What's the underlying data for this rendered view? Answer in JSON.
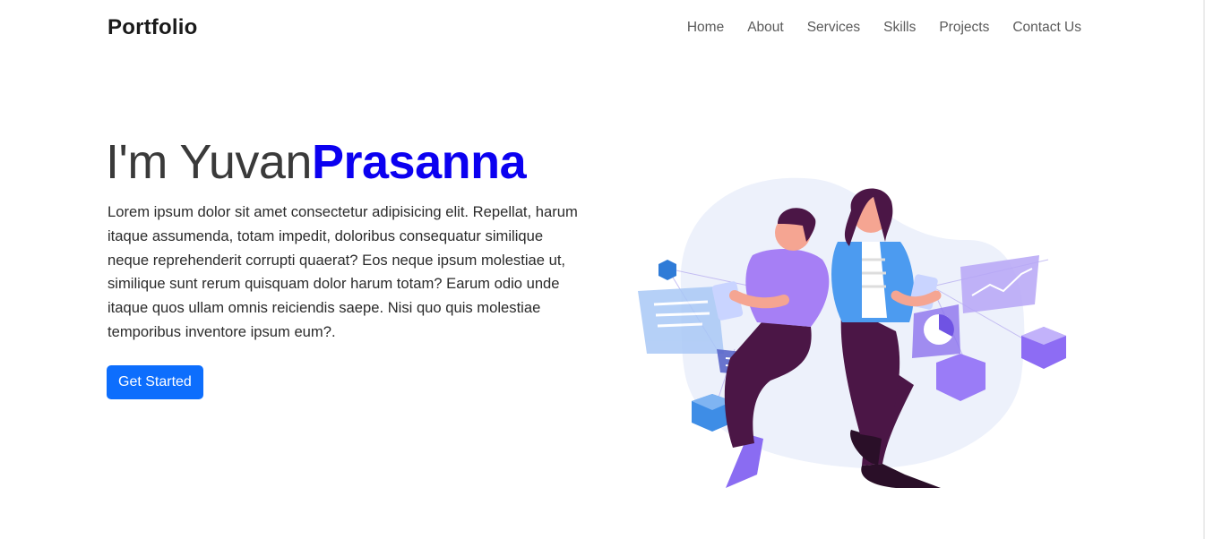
{
  "navbar": {
    "brand": "Portfolio",
    "links": [
      "Home",
      "About",
      "Services",
      "Skills",
      "Projects",
      "Contact Us"
    ]
  },
  "hero": {
    "title_prefix": "I'm Yuvan",
    "title_accent": "Prasanna",
    "description": "Lorem ipsum dolor sit amet consectetur adipisicing elit. Repellat, harum itaque assumenda, totam impedit, doloribus consequatur similique neque reprehenderit corrupti quaerat? Eos neque ipsum molestiae ut, similique sunt rerum quisquam dolor harum totam? Earum odio unde itaque quos ullam omnis reiciendis saepe. Nisi quo quis molestiae temporibus inventore ipsum eum?.",
    "cta_label": "Get Started"
  },
  "colors": {
    "accent": "#0b00f0",
    "button": "#0d6efd",
    "illustration_purple": "#9b7cf5",
    "illustration_blob": "#edf1fb"
  }
}
